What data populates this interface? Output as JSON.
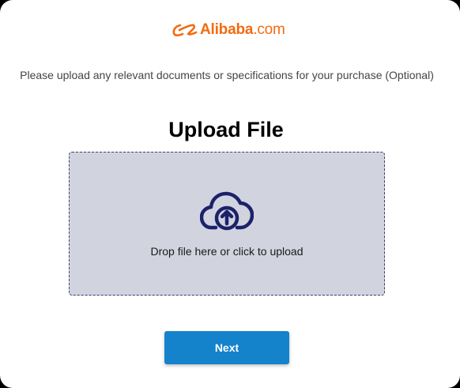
{
  "logo": {
    "brand": "Alibaba",
    "tld": ".com",
    "icon": "alibaba-logo-icon",
    "color": "#f26b10"
  },
  "subtitle": "Please upload any relevant documents or specifications for your purchase (Optional)",
  "upload": {
    "title": "Upload File",
    "drop_text": "Drop file here or click to upload",
    "icon": "cloud-upload-icon",
    "background": "#d1d3df",
    "icon_color": "#1c2269"
  },
  "actions": {
    "next_label": "Next",
    "button_color": "#1582cc"
  }
}
